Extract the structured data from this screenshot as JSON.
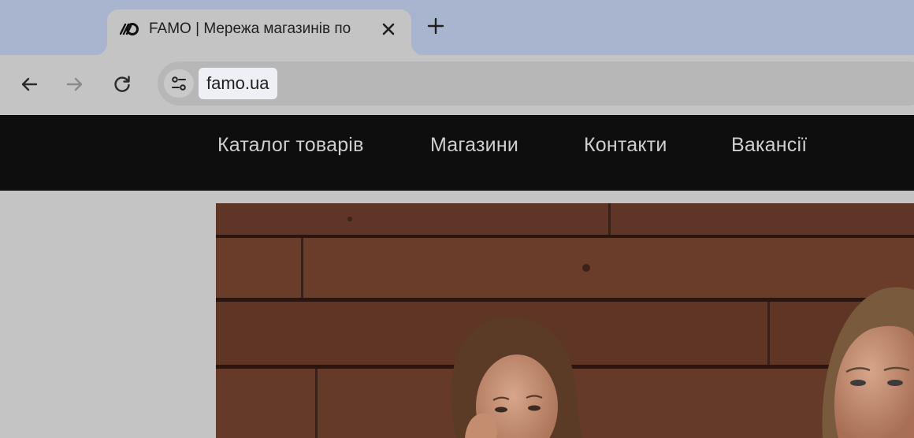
{
  "browser": {
    "tab": {
      "title": "FAMO | Мережа магазинів по",
      "favicon": "famo-logo-icon"
    },
    "new_tab_icon": "plus-icon",
    "toolbar": {
      "back_icon": "arrow-left-icon",
      "forward_icon": "arrow-right-icon",
      "reload_icon": "reload-icon",
      "site_info_icon": "tune-icon",
      "url": "famo.ua"
    },
    "colors": {
      "tab_strip": "#a9b5cf",
      "active_tab": "#c4c4c4",
      "omnibox": "#b7b7b7",
      "url_chip": "#eef0f6"
    }
  },
  "site": {
    "nav": {
      "items": [
        {
          "label": "Каталог товарів"
        },
        {
          "label": "Магазини"
        },
        {
          "label": "Контакти"
        },
        {
          "label": "Вакансії"
        }
      ]
    },
    "hero": {
      "image": "hero-photo-two-women-wooden-wall"
    },
    "colors": {
      "header_bg": "#0e0e0e",
      "nav_text": "#cfcfcf",
      "page_bg": "#c4c4c4",
      "wood": "#6b3f2c"
    }
  }
}
